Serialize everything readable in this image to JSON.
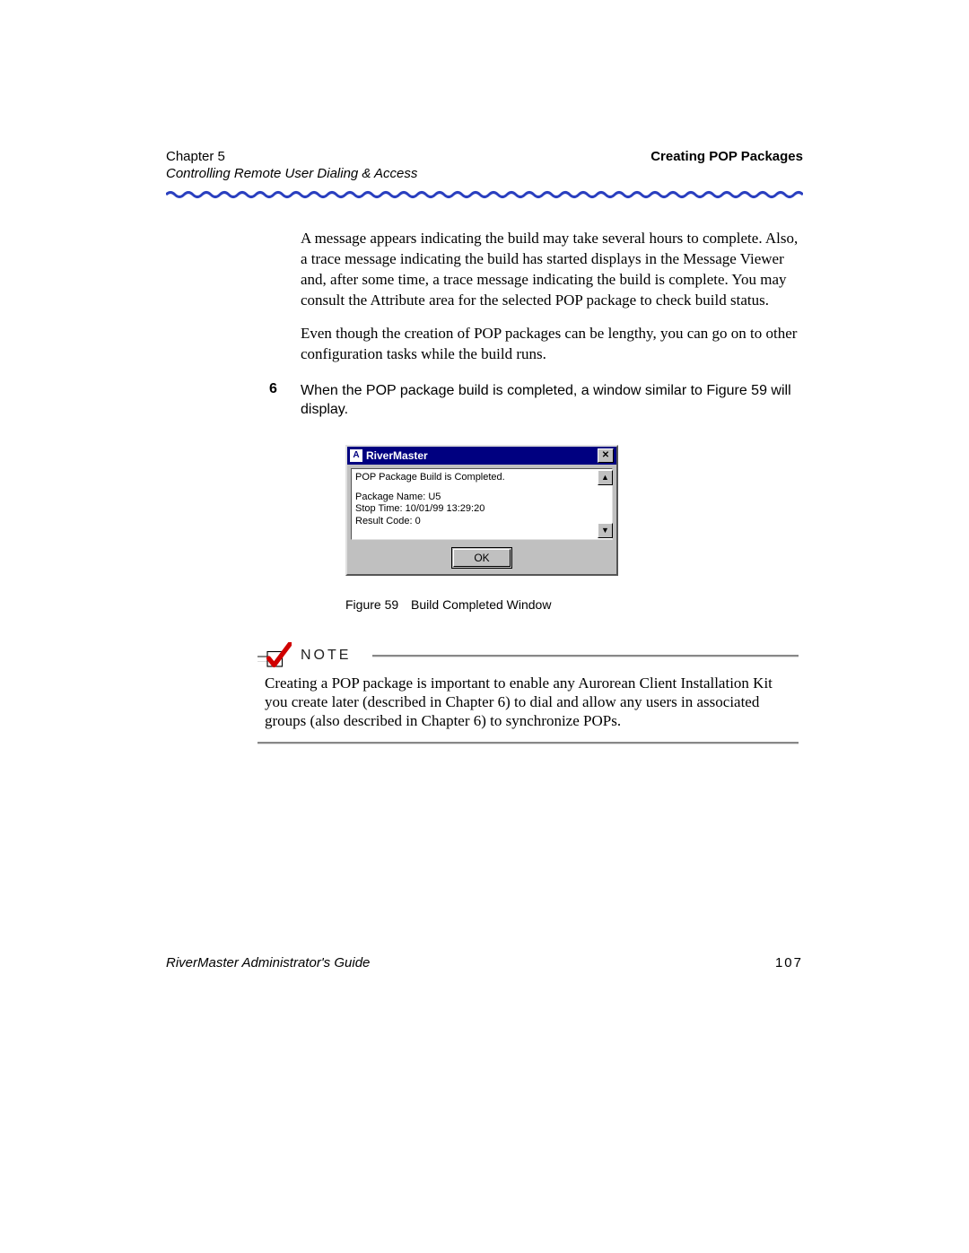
{
  "header": {
    "chapter": "Chapter 5",
    "section_title": "Creating POP Packages",
    "subtitle": "Controlling Remote User Dialing & Access"
  },
  "body": {
    "para1": "A message appears indicating the build may take several hours to complete. Also, a trace message indicating the build has started displays in the Message Viewer and, after some time, a trace message indicating the build is complete. You may consult the Attribute area for the selected POP package to check build status.",
    "para2": "Even though the creation of POP packages can be lengthy, you can go on to other configuration tasks while the build runs."
  },
  "step": {
    "number": "6",
    "text": "When the POP package build is completed, a window similar to Figure 59 will display."
  },
  "dialog": {
    "title": "RiverMaster",
    "line1": "POP Package Build is Completed.",
    "line2": "Package Name:  U5",
    "line3": "Stop Time:        10/01/99 13:29:20",
    "line4": "Result Code:    0",
    "ok": "OK"
  },
  "figure": {
    "label": "Figure 59",
    "caption": "Build Completed Window"
  },
  "note": {
    "label": "NOTE",
    "text": "Creating a POP package is important to enable any Aurorean Client Installation Kit you create later (described in Chapter 6) to dial and allow any users in associated groups (also described in Chapter 6) to synchronize POPs."
  },
  "footer": {
    "guide": "RiverMaster Administrator's Guide",
    "page": "107"
  }
}
